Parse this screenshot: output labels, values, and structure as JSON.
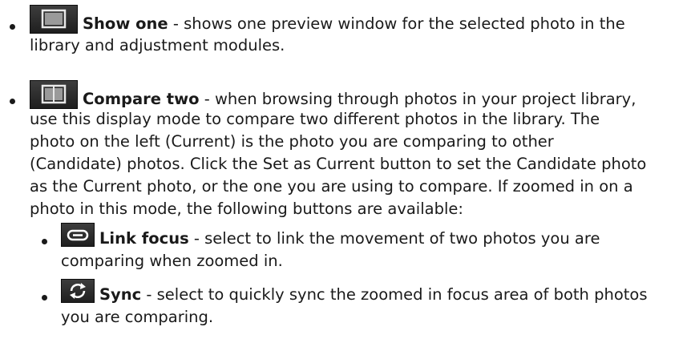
{
  "items": [
    {
      "title": "Show one",
      "lines": [
        " - shows one preview window for the selected photo in the",
        "library and adjustment modules."
      ],
      "icon": "single-view-icon"
    },
    {
      "title": "Compare two",
      "lines": [
        " - when browsing through photos in your project library,",
        "use this display mode to compare two different photos in the library. The",
        "photo on the left (Current) is the photo you are comparing to other",
        "(Candidate) photos. Click the Set as Current button to set the Candidate photo",
        "as the Current photo, or the one you are using to compare. If zoomed in on a",
        "photo in this mode, the following buttons are available:"
      ],
      "icon": "compare-view-icon"
    }
  ],
  "subitems": [
    {
      "title": "Link focus",
      "lines": [
        " - select to link the movement of two photos you are",
        "comparing when zoomed in."
      ],
      "icon": "link-icon"
    },
    {
      "title": "Sync",
      "lines": [
        " - select to quickly sync the zoomed in focus area of both photos",
        "you are comparing."
      ],
      "icon": "sync-icon"
    }
  ]
}
